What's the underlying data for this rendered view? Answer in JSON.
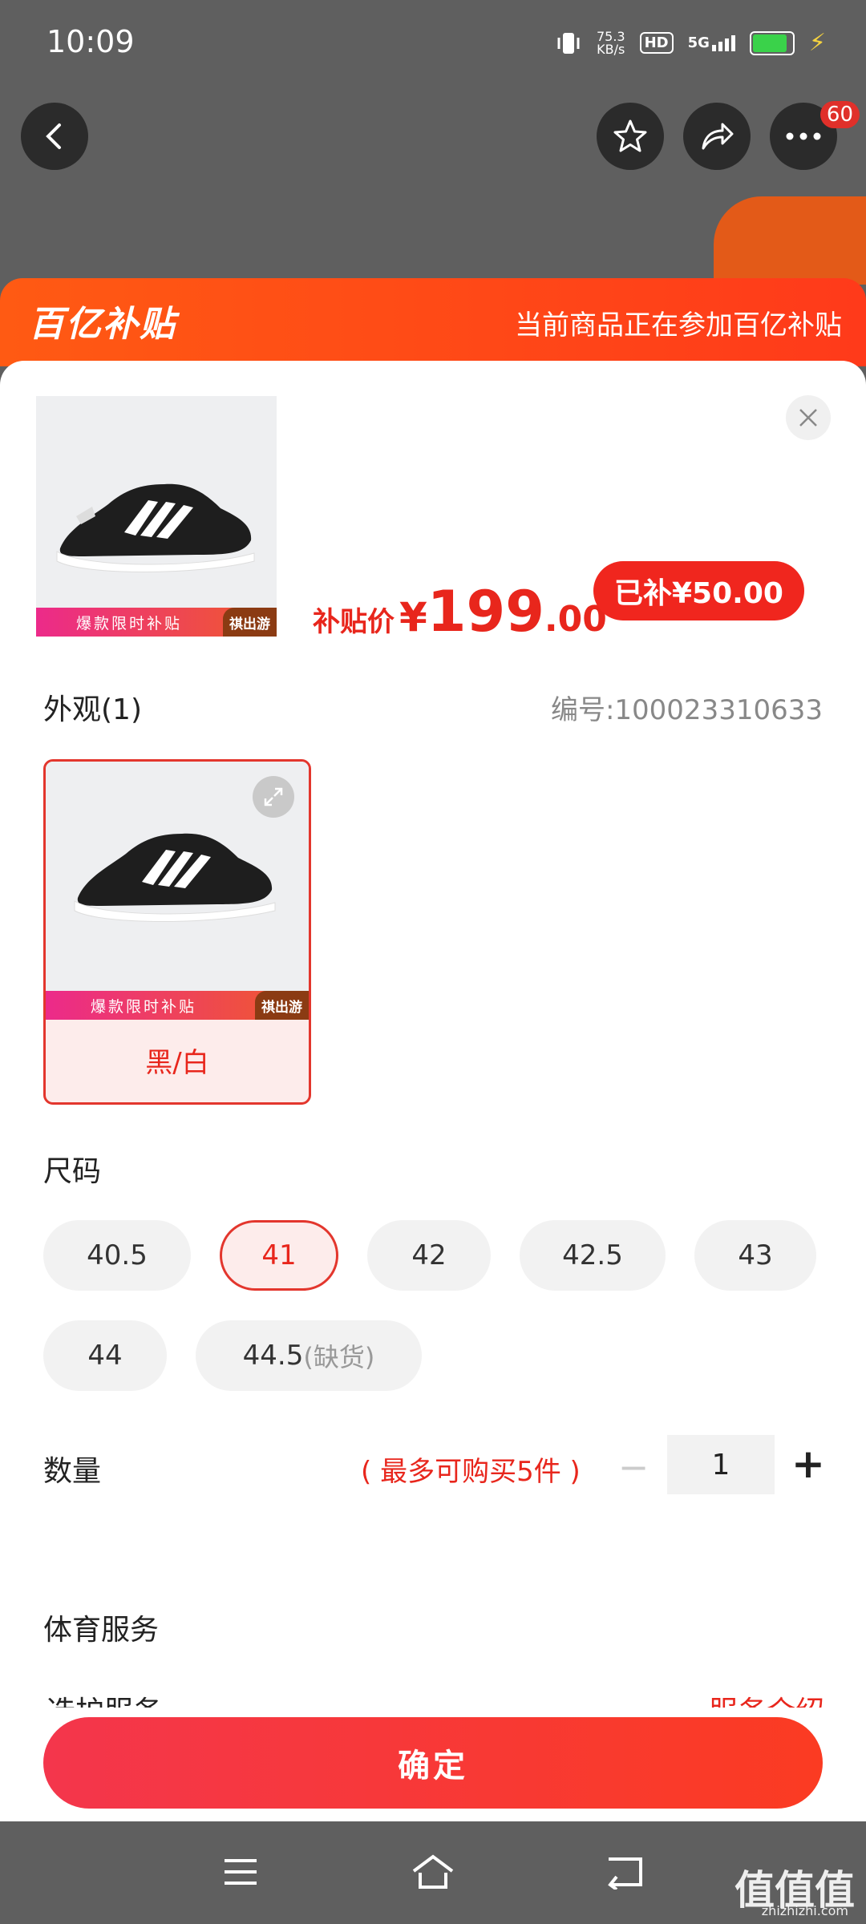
{
  "status_bar": {
    "time": "10:09",
    "net_speed_value": "75.3",
    "net_speed_unit": "KB/s",
    "hd": "HD",
    "signal": "5G",
    "battery_level_percent": 80
  },
  "top_nav": {
    "back_icon": "chevron-left-icon",
    "favorite_icon": "star-icon",
    "share_icon": "share-icon",
    "more_icon": "more-dots-icon",
    "more_badge": "60"
  },
  "subsidy_banner": {
    "logo_text": "百亿补贴",
    "message": "当前商品正在参加百亿补贴"
  },
  "product": {
    "promo_text": "爆款限时补贴",
    "promo_brand": "祺出游",
    "price_label": "补贴价",
    "currency": "¥",
    "price_int": "199",
    "price_dec": ".00",
    "subsidy_amount": "已补¥50.00"
  },
  "appearance": {
    "title": "外观(1)",
    "sku_code": "编号:100023310633",
    "variants": [
      {
        "label": "黑/白",
        "promo_text": "爆款限时补贴",
        "promo_brand": "祺出游"
      }
    ]
  },
  "sizes": {
    "title": "尺码",
    "options": [
      "40.5",
      "41",
      "42",
      "42.5",
      "43",
      "44",
      "44.5"
    ],
    "selected": "41",
    "out_of_stock_note": "(缺货)"
  },
  "quantity": {
    "title": "数量",
    "limit": "( 最多可购买5件 )",
    "minus": "−",
    "value": "1",
    "plus": "+"
  },
  "sports_service": {
    "title": "体育服务",
    "item_label": "选护服务",
    "item_link": "服务介绍"
  },
  "confirm_label": "确定",
  "watermark": {
    "logo": "值值值",
    "domain": "zhizhizhi.com"
  },
  "colors": {
    "accent": "#e8261c",
    "banner": "#ff4a17"
  }
}
